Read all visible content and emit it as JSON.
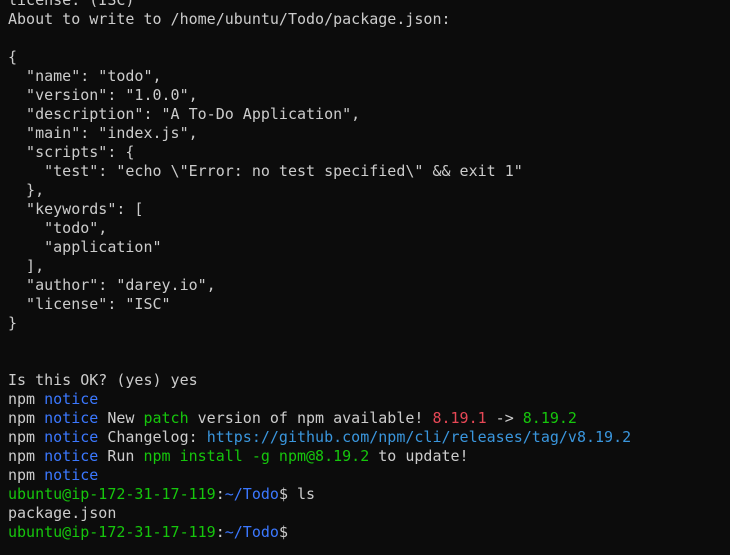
{
  "terminal": {
    "lines": [
      [
        {
          "t": "license: (ISC)",
          "c": "white"
        }
      ],
      [
        {
          "t": "About to write to /home/ubuntu/Todo/package.json:",
          "c": "white"
        }
      ],
      [
        {
          "t": "",
          "c": "white"
        }
      ],
      [
        {
          "t": "{",
          "c": "white"
        }
      ],
      [
        {
          "t": "  \"name\": \"todo\",",
          "c": "white"
        }
      ],
      [
        {
          "t": "  \"version\": \"1.0.0\",",
          "c": "white"
        }
      ],
      [
        {
          "t": "  \"description\": \"A To-Do Application\",",
          "c": "white"
        }
      ],
      [
        {
          "t": "  \"main\": \"index.js\",",
          "c": "white"
        }
      ],
      [
        {
          "t": "  \"scripts\": {",
          "c": "white"
        }
      ],
      [
        {
          "t": "    \"test\": \"echo \\\"Error: no test specified\\\" && exit 1\"",
          "c": "white"
        }
      ],
      [
        {
          "t": "  },",
          "c": "white"
        }
      ],
      [
        {
          "t": "  \"keywords\": [",
          "c": "white"
        }
      ],
      [
        {
          "t": "    \"todo\",",
          "c": "white"
        }
      ],
      [
        {
          "t": "    \"application\"",
          "c": "white"
        }
      ],
      [
        {
          "t": "  ],",
          "c": "white"
        }
      ],
      [
        {
          "t": "  \"author\": \"darey.io\",",
          "c": "white"
        }
      ],
      [
        {
          "t": "  \"license\": \"ISC\"",
          "c": "white"
        }
      ],
      [
        {
          "t": "}",
          "c": "white"
        }
      ],
      [
        {
          "t": "",
          "c": "white"
        }
      ],
      [
        {
          "t": "",
          "c": "white"
        }
      ],
      [
        {
          "t": "Is this OK? (yes) yes",
          "c": "white"
        }
      ],
      [
        {
          "t": "npm ",
          "c": "white"
        },
        {
          "t": "notice",
          "c": "blue"
        }
      ],
      [
        {
          "t": "npm ",
          "c": "white"
        },
        {
          "t": "notice",
          "c": "blue"
        },
        {
          "t": " New ",
          "c": "white"
        },
        {
          "t": "patch",
          "c": "green"
        },
        {
          "t": " version of npm available! ",
          "c": "white"
        },
        {
          "t": "8.19.1",
          "c": "red"
        },
        {
          "t": " -> ",
          "c": "white"
        },
        {
          "t": "8.19.2",
          "c": "green"
        }
      ],
      [
        {
          "t": "npm ",
          "c": "white"
        },
        {
          "t": "notice",
          "c": "blue"
        },
        {
          "t": " Changelog: ",
          "c": "white"
        },
        {
          "t": "https://github.com/npm/cli/releases/tag/v8.19.2",
          "c": "cyan"
        }
      ],
      [
        {
          "t": "npm ",
          "c": "white"
        },
        {
          "t": "notice",
          "c": "blue"
        },
        {
          "t": " Run ",
          "c": "white"
        },
        {
          "t": "npm install -g npm@8.19.2",
          "c": "green"
        },
        {
          "t": " to update!",
          "c": "white"
        }
      ],
      [
        {
          "t": "npm ",
          "c": "white"
        },
        {
          "t": "notice",
          "c": "blue"
        }
      ],
      [
        {
          "t": "ubuntu@ip-172-31-17-119",
          "c": "green"
        },
        {
          "t": ":",
          "c": "white"
        },
        {
          "t": "~/Todo",
          "c": "blue"
        },
        {
          "t": "$ ls",
          "c": "white"
        }
      ],
      [
        {
          "t": "package.json",
          "c": "white"
        }
      ],
      [
        {
          "t": "ubuntu@ip-172-31-17-119",
          "c": "green"
        },
        {
          "t": ":",
          "c": "white"
        },
        {
          "t": "~/Todo",
          "c": "blue"
        },
        {
          "t": "$",
          "c": "white"
        }
      ]
    ]
  },
  "colors": {
    "background": "#0c0c0c",
    "white": "#cccccc",
    "blue": "#3b78ff",
    "green": "#16c60c",
    "red": "#e74856",
    "cyan": "#3a96dd"
  }
}
